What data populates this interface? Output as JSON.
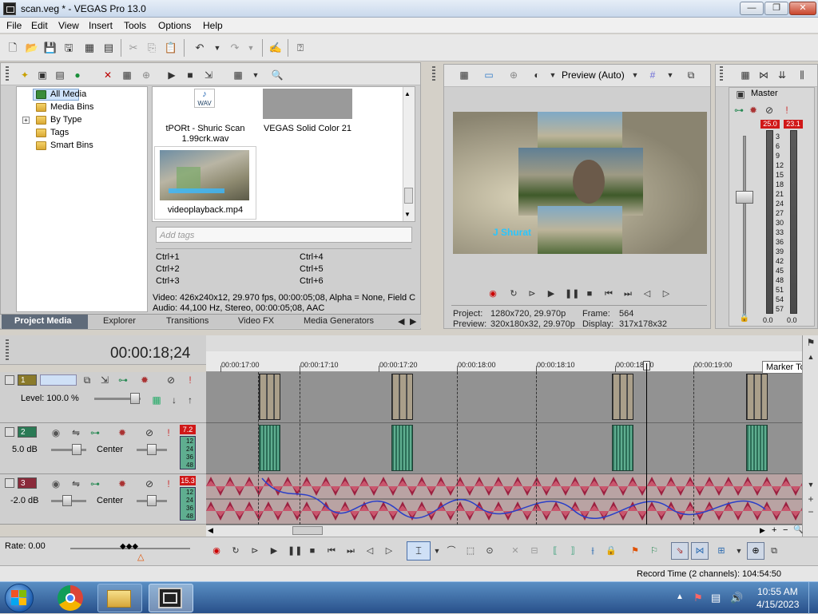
{
  "window": {
    "title": "scan.veg * - VEGAS Pro 13.0"
  },
  "menu": [
    "File",
    "Edit",
    "View",
    "Insert",
    "Tools",
    "Options",
    "Help"
  ],
  "project_media": {
    "tree": [
      {
        "label": "All Media",
        "selected": true
      },
      {
        "label": "Media Bins"
      },
      {
        "label": "By Type",
        "expandable": true
      },
      {
        "label": "Tags"
      },
      {
        "label": "Smart Bins"
      }
    ],
    "items": [
      {
        "name": "tPORt - Shuric Scan 1.99crk.wav",
        "badge": "WAV"
      },
      {
        "name": "VEGAS Solid Color 21"
      },
      {
        "name": "videoplayback.mp4"
      }
    ],
    "tags_placeholder": "Add tags",
    "shortcuts": [
      "Ctrl+1",
      "Ctrl+4",
      "Ctrl+2",
      "Ctrl+5",
      "Ctrl+3",
      "Ctrl+6"
    ],
    "info_video": "Video: 426x240x12, 29.970 fps, 00:00:05;08, Alpha = None, Field C",
    "info_audio": "Audio: 44,100 Hz, Stereo, 00:00:05;08, AAC",
    "tabs": [
      "Project Media",
      "Explorer",
      "Transitions",
      "Video FX",
      "Media Generators"
    ]
  },
  "preview": {
    "mode": "Preview (Auto)",
    "project_label": "Project:",
    "project_value": "1280x720, 29.970p",
    "preview_label": "Preview:",
    "preview_value": "320x180x32, 29.970p",
    "frame_label": "Frame:",
    "frame_value": "564",
    "display_label": "Display:",
    "display_value": "317x178x32",
    "overlay_text": "J Shurat"
  },
  "mixer": {
    "title": "Master",
    "peak_left": "25.0",
    "peak_right": "23.1",
    "scale": [
      "3",
      "6",
      "9",
      "12",
      "15",
      "18",
      "21",
      "24",
      "27",
      "30",
      "33",
      "36",
      "39",
      "42",
      "45",
      "48",
      "51",
      "54",
      "57"
    ],
    "bottom_left": "0.0",
    "bottom_right": "0.0"
  },
  "timeline": {
    "timecode": "00:00:18;24",
    "ruler": [
      "00:00:17:00",
      "00:00:17:10",
      "00:00:17:20",
      "00:00:18:00",
      "00:00:18:10",
      "00:00:18:20",
      "00:00:19:00"
    ],
    "tooltip": "Marker Tool",
    "tracks": [
      {
        "num": "1",
        "type": "video",
        "level_label": "Level: 100.0 %",
        "color": "#8a7a2a"
      },
      {
        "num": "2",
        "type": "audio",
        "vol": "5.0 dB",
        "pan": "Center",
        "peak": "7.2",
        "color": "#2a7a55"
      },
      {
        "num": "3",
        "type": "audio",
        "vol": "-2.0 dB",
        "pan": "Center",
        "peak": "15.3",
        "color": "#8a2a3a"
      }
    ],
    "track_scale": [
      "12",
      "24",
      "36",
      "48"
    ]
  },
  "transport": {
    "rate": "Rate: 0.00"
  },
  "status": {
    "record_time": "Record Time (2 channels): 104:54:50"
  },
  "taskbar": {
    "time": "10:55 AM",
    "date": "4/15/2023"
  }
}
